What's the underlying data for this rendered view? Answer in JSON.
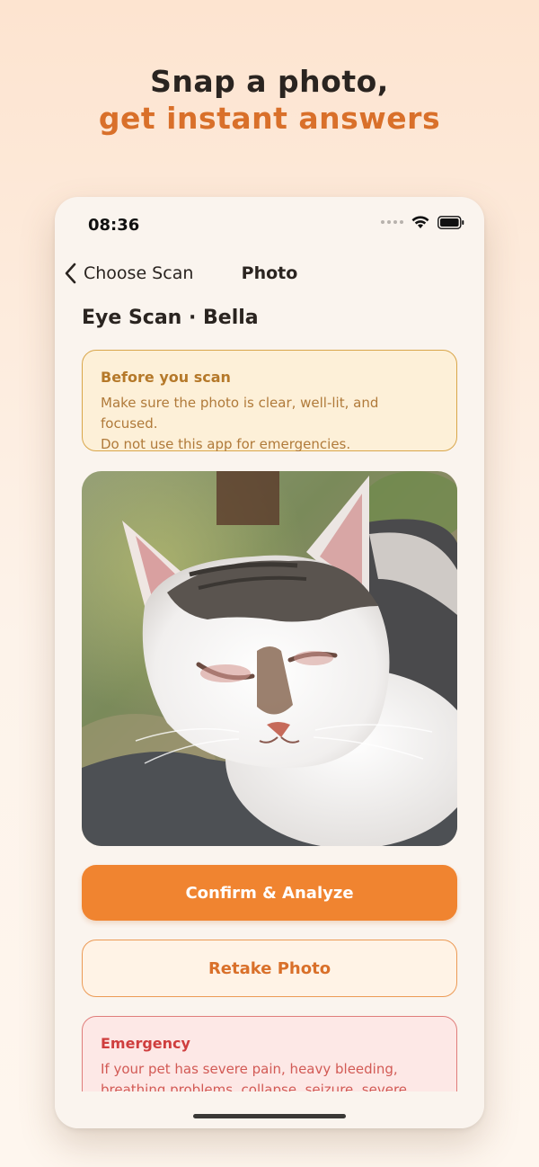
{
  "headline": {
    "line1": "Snap a photo,",
    "line2": "get instant answers"
  },
  "status_bar": {
    "time": "08:36",
    "icons": [
      "signal-dots-icon",
      "wifi-icon",
      "battery-icon"
    ]
  },
  "nav": {
    "back_label": "Choose Scan",
    "title": "Photo"
  },
  "page_title": "Eye Scan · Bella",
  "notice": {
    "title": "Before you scan",
    "body_line1": "Make sure the photo is clear, well-lit, and focused.",
    "body_line2": "Do not use this app for emergencies."
  },
  "photo": {
    "subject": "cat-photo"
  },
  "actions": {
    "confirm_label": "Confirm & Analyze",
    "retake_label": "Retake Photo"
  },
  "emergency": {
    "title": "Emergency",
    "body_line1": "If your pet has severe pain, heavy bleeding,",
    "body_line2": "breathing problems, collapse, seizure, severe"
  },
  "colors": {
    "accent": "#f08430",
    "accent_text": "#d9702a",
    "notice_bg": "#fdf0d8",
    "emergency_bg": "#fde8e6"
  }
}
